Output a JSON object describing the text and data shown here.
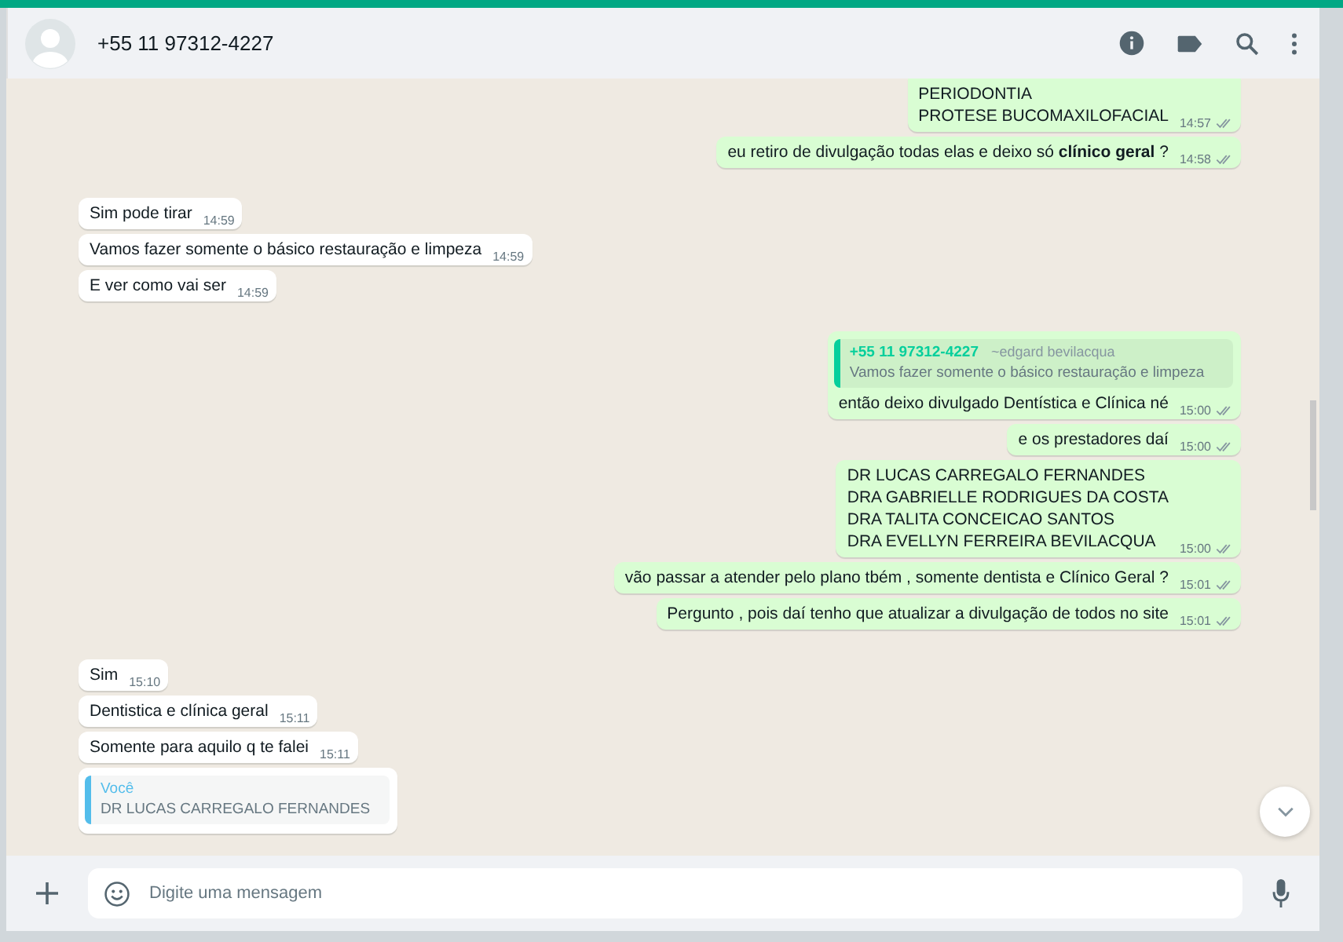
{
  "header": {
    "contact": "+55 11 97312-4227"
  },
  "messages": [
    {
      "kind": "outgoing",
      "lines": [
        "PERIODONTIA",
        "PROTESE BUCOMAXILOFACIAL"
      ],
      "time": "14:57"
    },
    {
      "kind": "outgoing",
      "lines": [
        "eu retiro de divulgação todas elas e deixo só **clínico geral** ?"
      ],
      "time": "14:58"
    },
    {
      "kind": "incoming",
      "lines": [
        "Sim pode tirar"
      ],
      "time": "14:59"
    },
    {
      "kind": "incoming",
      "lines": [
        "Vamos fazer somente o básico restauração e limpeza"
      ],
      "time": "14:59"
    },
    {
      "kind": "incoming",
      "lines": [
        "E ver como vai ser"
      ],
      "time": "14:59"
    },
    {
      "kind": "outgoing",
      "quote": {
        "author": "+55 11 97312-4227",
        "note": "~edgard bevilacqua",
        "text": "Vamos fazer somente o básico restauração e limpeza",
        "color": "#06cf9c"
      },
      "lines": [
        "então deixo divulgado Dentística e Clínica né"
      ],
      "time": "15:00"
    },
    {
      "kind": "outgoing",
      "lines": [
        "e os prestadores daí"
      ],
      "time": "15:00"
    },
    {
      "kind": "outgoing",
      "lines": [
        "DR LUCAS CARREGALO FERNANDES",
        "DRA GABRIELLE RODRIGUES DA COSTA",
        "DRA TALITA CONCEICAO SANTOS",
        "DRA EVELLYN FERREIRA BEVILACQUA"
      ],
      "time": "15:00"
    },
    {
      "kind": "outgoing",
      "lines": [
        "vão passar a atender pelo plano tbém , somente dentista e Clínico Geral ?"
      ],
      "time": "15:01"
    },
    {
      "kind": "outgoing",
      "lines": [
        "Pergunto , pois daí tenho que atualizar a divulgação de todos no site"
      ],
      "time": "15:01"
    },
    {
      "kind": "incoming",
      "lines": [
        "Sim"
      ],
      "time": "15:10"
    },
    {
      "kind": "incoming",
      "lines": [
        "Dentistica e clínica geral"
      ],
      "time": "15:11"
    },
    {
      "kind": "incoming",
      "lines": [
        "Somente para aquilo q te falei"
      ],
      "time": "15:11"
    },
    {
      "kind": "incoming",
      "quote": {
        "author": "Você",
        "text": "DR LUCAS CARREGALO FERNANDES",
        "color": "#53bdeb"
      }
    }
  ],
  "composer": {
    "placeholder": "Digite uma mensagem"
  }
}
